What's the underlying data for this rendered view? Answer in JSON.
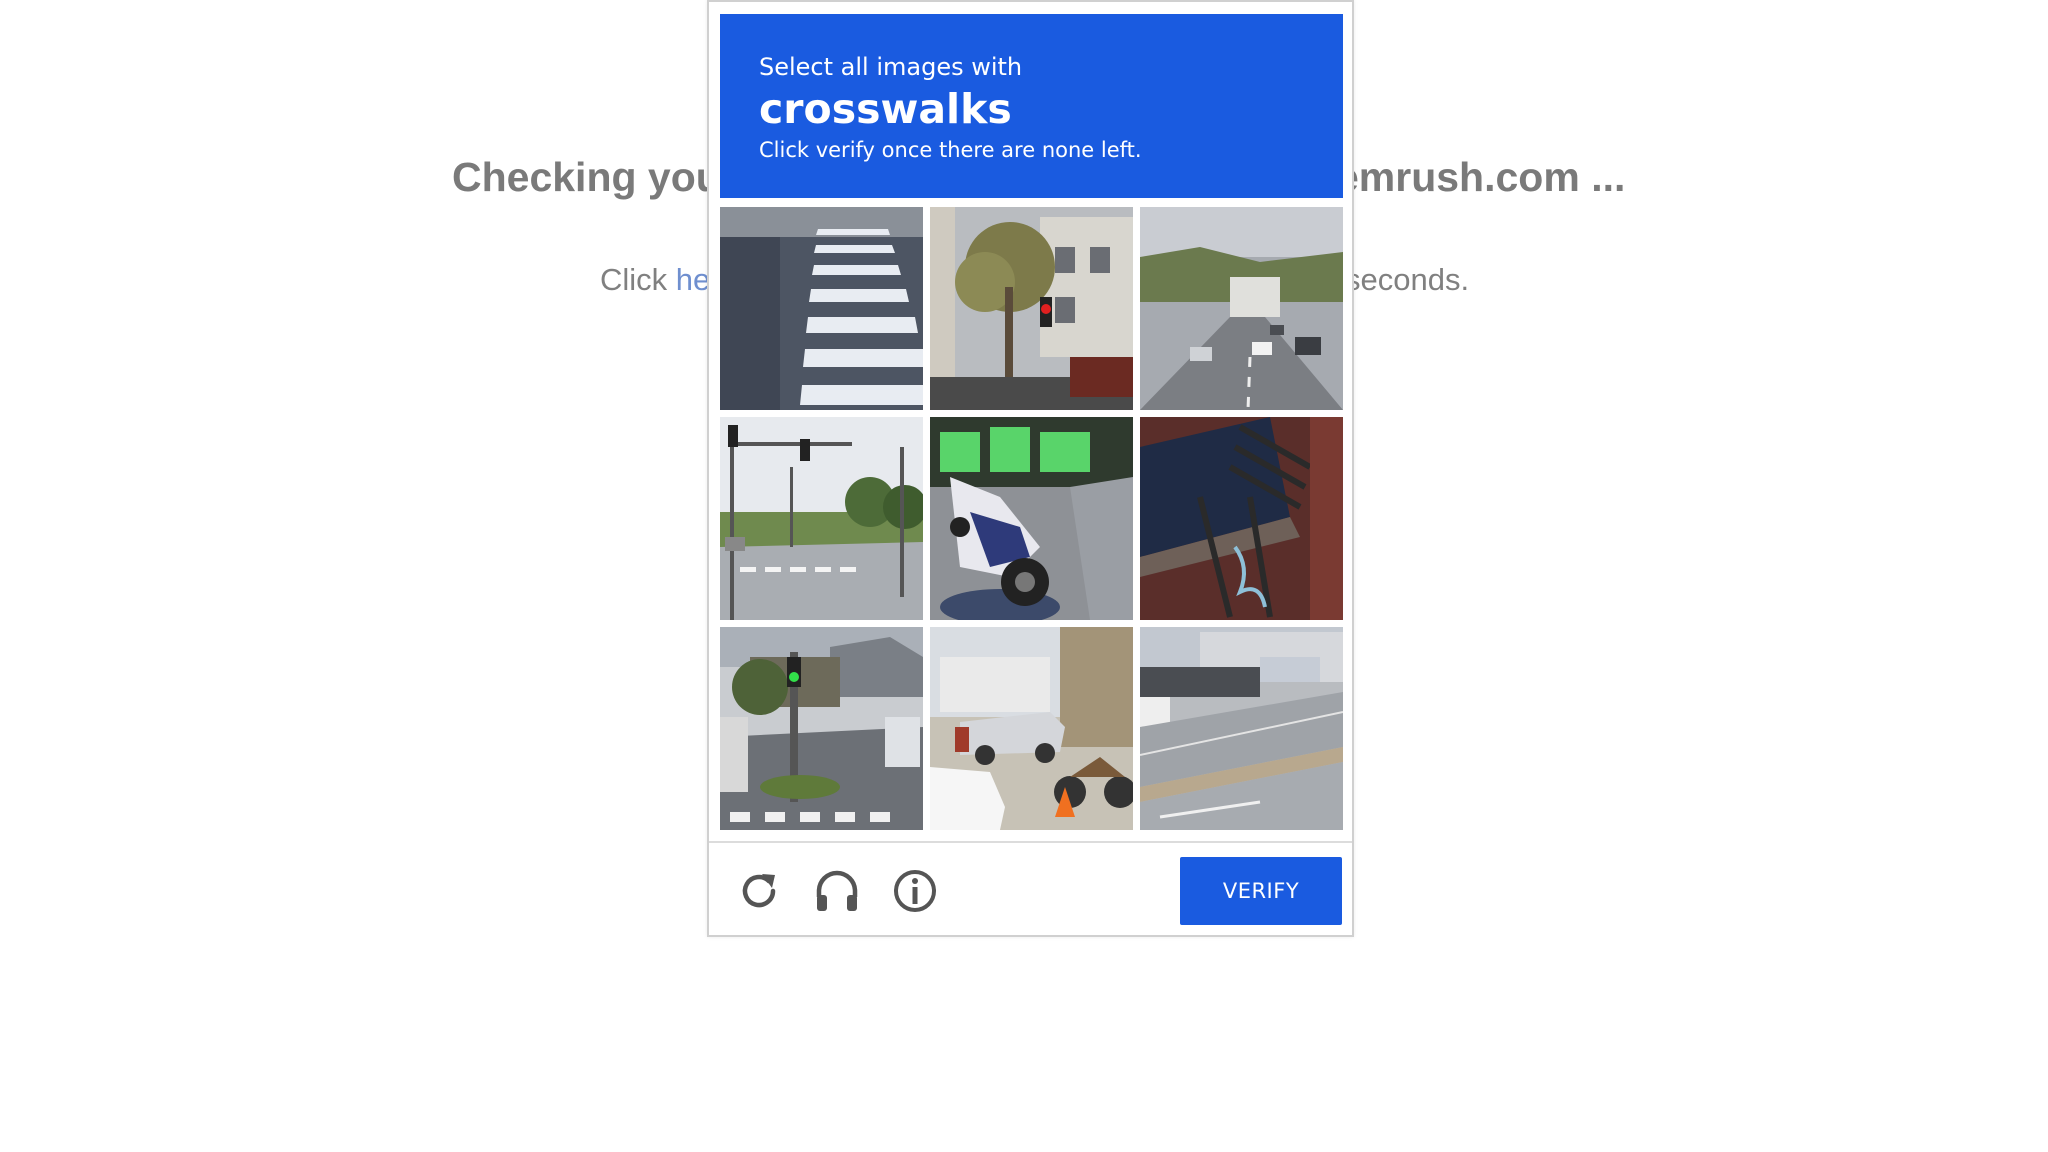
{
  "background": {
    "heading_left": "Checking you",
    "heading_right": "emrush.com ...",
    "sub_left": "Click ",
    "sub_link": "he",
    "sub_right": "seconds."
  },
  "captcha": {
    "instruction": "Select all images with",
    "keyword": "crosswalks",
    "hint": "Click verify once there are none left.",
    "tiles": [
      {
        "label": "crosswalk stripes"
      },
      {
        "label": "tree and traffic light"
      },
      {
        "label": "highway traffic"
      },
      {
        "label": "intersection with traffic lights"
      },
      {
        "label": "motorcycle"
      },
      {
        "label": "fire escape"
      },
      {
        "label": "street with green light"
      },
      {
        "label": "parked cars and motorbike"
      },
      {
        "label": "road with cars"
      }
    ],
    "footer": {
      "reload_icon": "reload-icon",
      "audio_icon": "headphones-icon",
      "info_icon": "info-icon",
      "verify_label": "VERIFY"
    },
    "colors": {
      "accent": "#1a5be0",
      "icon": "#555555"
    }
  }
}
